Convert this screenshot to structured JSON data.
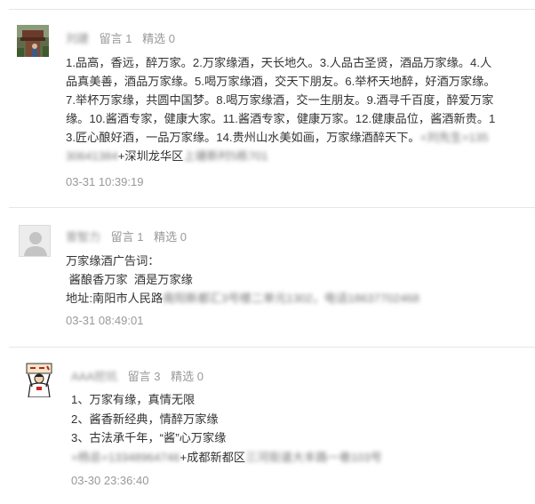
{
  "comments": [
    {
      "author": "刘建",
      "message_label": "留言 1",
      "featured_label": "精选 0",
      "lines": [
        "1.品高，香远，醉万家。2.万家缘酒，天长地久。3.人品古圣贤，酒品万家缘。4.人",
        "品真美善，酒品万家缘。5.喝万家缘酒，交天下朋友。6.举杯天地醉，好酒万家缘。",
        "7.举杯万家缘，共圆中国梦。8.喝万家缘酒，交一生朋友。9.酒寻千百度，醉爱万家",
        "缘。10.酱酒专家，健康大家。11.酱酒专家，健康万家。12.健康品位，酱酒新贵。1",
        "3.匠心酿好酒，一品万家缘。14.贵州山水美如画，万家缘酒醉天下。"
      ],
      "line5_blurred": "+刘先生+135",
      "line6_blurred_start": "30641384",
      "line6_text": "+深圳龙华区",
      "line6_blurred_end": "上塘新村5栋701",
      "time": "03-31 10:39:19"
    },
    {
      "author": "曾智力",
      "message_label": "留言 1",
      "featured_label": "精选 0",
      "lines": [
        "万家缘酒广告词：",
        " 酱酿香万家  酒是万家缘"
      ],
      "address_label": "地址:南阳市人民路",
      "address_blurred": "南阳新都汇3号楼二单元1302，电话18637702468",
      "time": "03-31 08:49:01"
    },
    {
      "author": "AAA挖坑",
      "message_label": "留言 3",
      "featured_label": "精选 0",
      "lines": [
        "1、万家有缘，真情无限",
        "2、酱香新经典，情醉万家缘",
        "3、古法承千年，“酱”心万家缘"
      ],
      "contact_blurred_start": "+杨总+13348964746",
      "contact_text": "+成都新都区",
      "contact_blurred_end": "三河街道大丰路一巷103号",
      "time": "03-30 23:36:40"
    }
  ]
}
